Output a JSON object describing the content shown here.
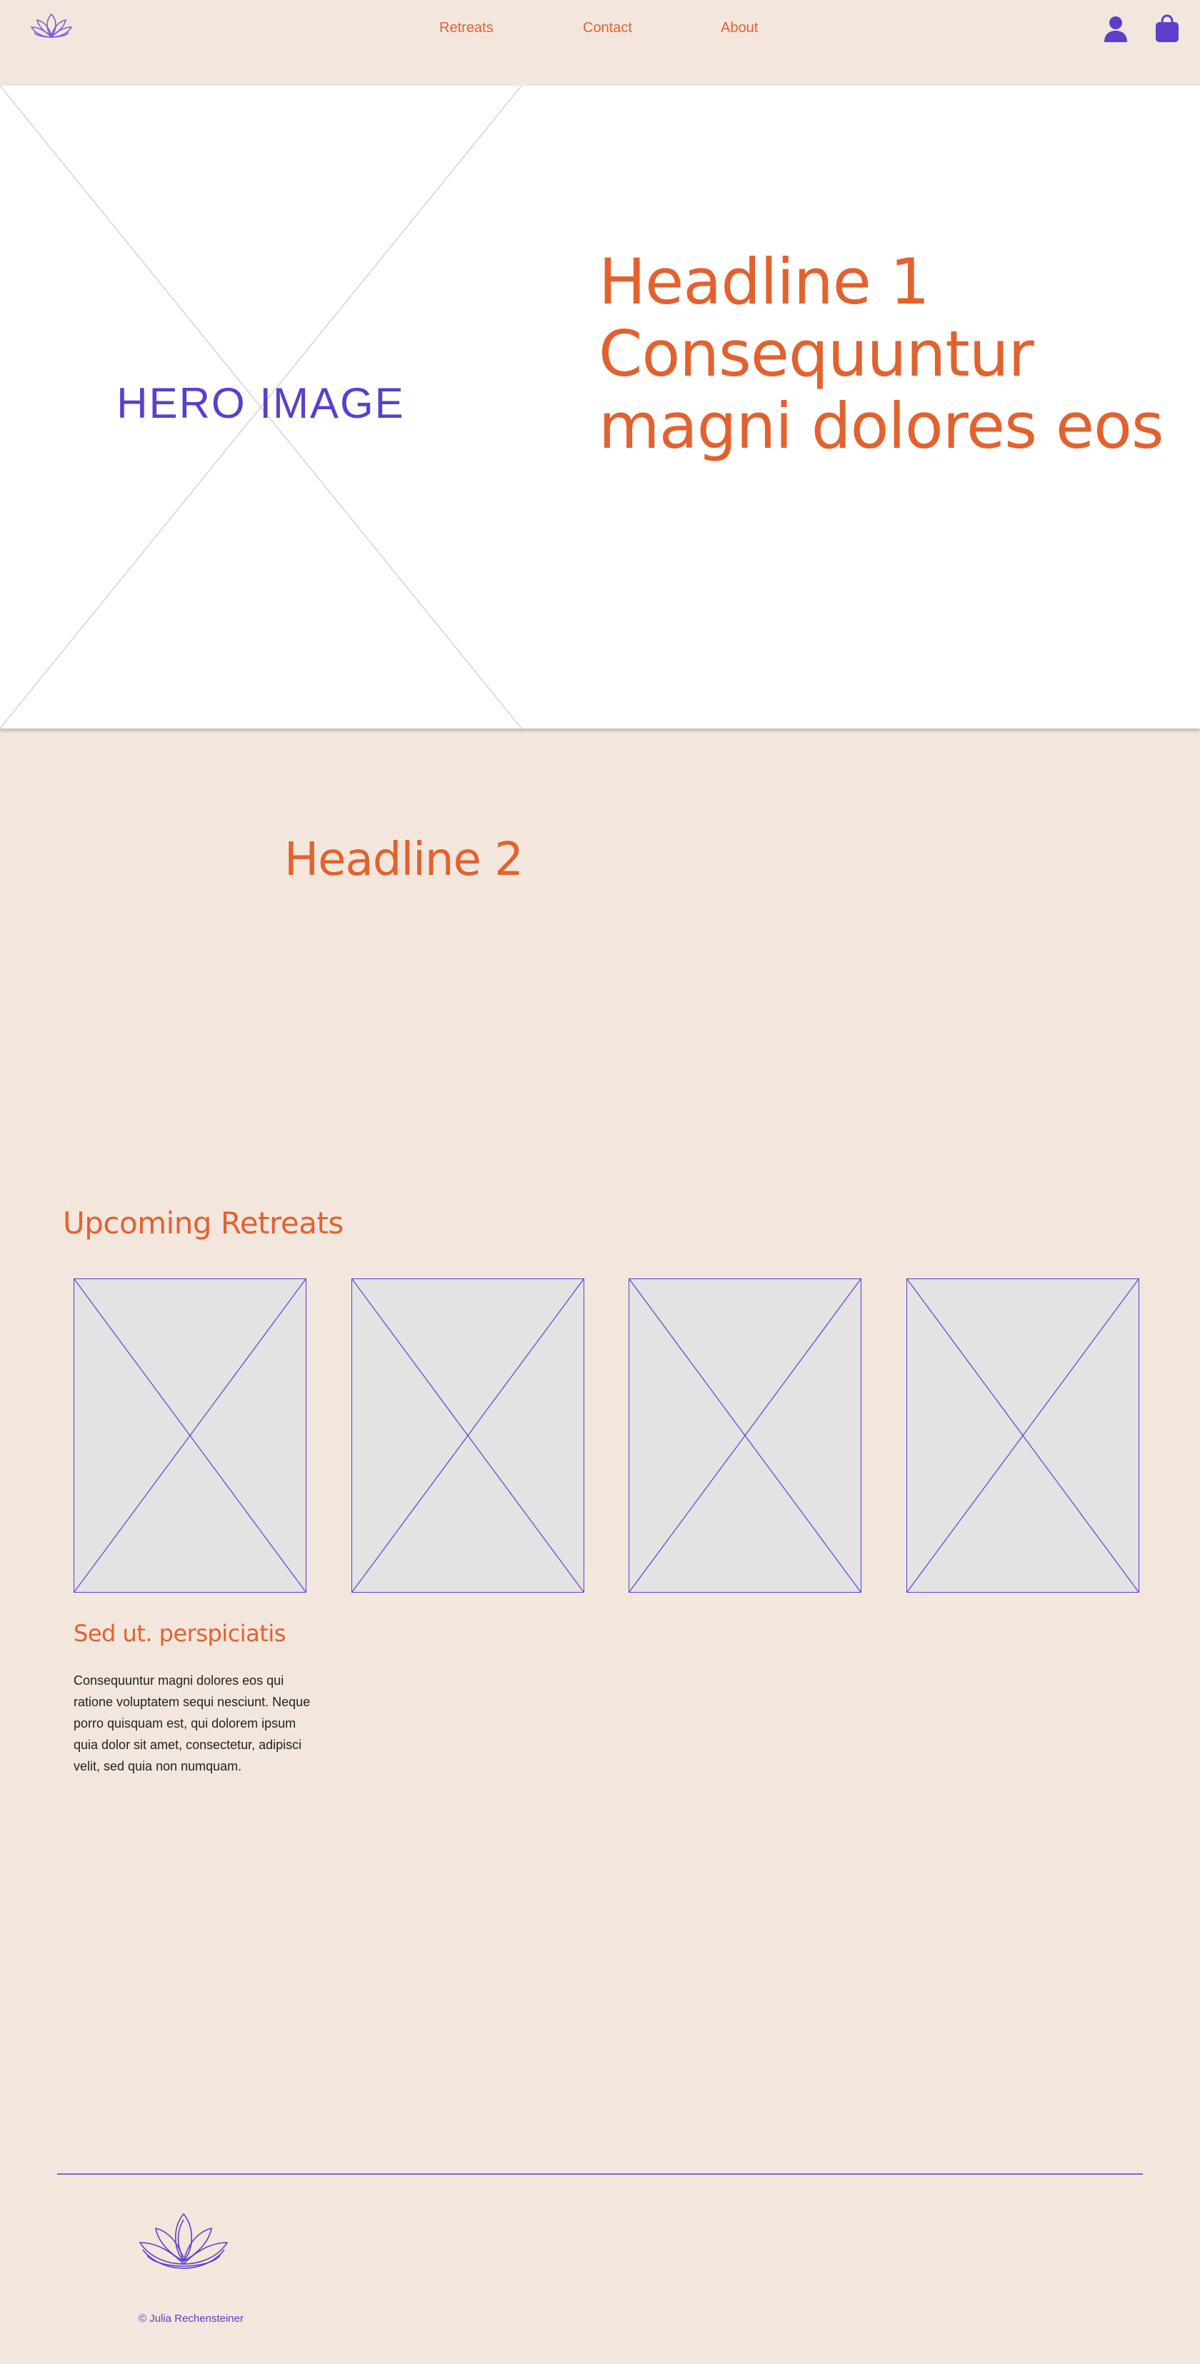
{
  "header": {
    "nav": [
      {
        "label": "Retreats"
      },
      {
        "label": "Contact"
      },
      {
        "label": "About"
      }
    ],
    "icons": [
      "lotus-logo-icon",
      "user-icon",
      "shopping-bag-icon"
    ]
  },
  "hero": {
    "image_label": "HERO IMAGE",
    "headline_lines": [
      "Headline 1",
      "Consequuntur",
      "magni dolores eos"
    ]
  },
  "intro": {
    "headline": "Headline 2"
  },
  "retreats": {
    "title": "Upcoming Retreats",
    "cards": [
      {
        "title": "Sed ut. perspiciatis",
        "text": "Consequuntur magni dolores eos qui ratione voluptatem sequi nesciunt. Neque porro quisquam est, qui dolorem ipsum quia dolor sit amet, consectetur, adipisci velit, sed quia non numquam."
      }
    ]
  },
  "footer": {
    "copyright": "© Julia Rechensteiner"
  },
  "colors": {
    "background": "#F3E6DD",
    "accent_orange": "#E2622F",
    "accent_purple": "#5B3FCC",
    "placeholder_gray": "#E4E3E3"
  }
}
